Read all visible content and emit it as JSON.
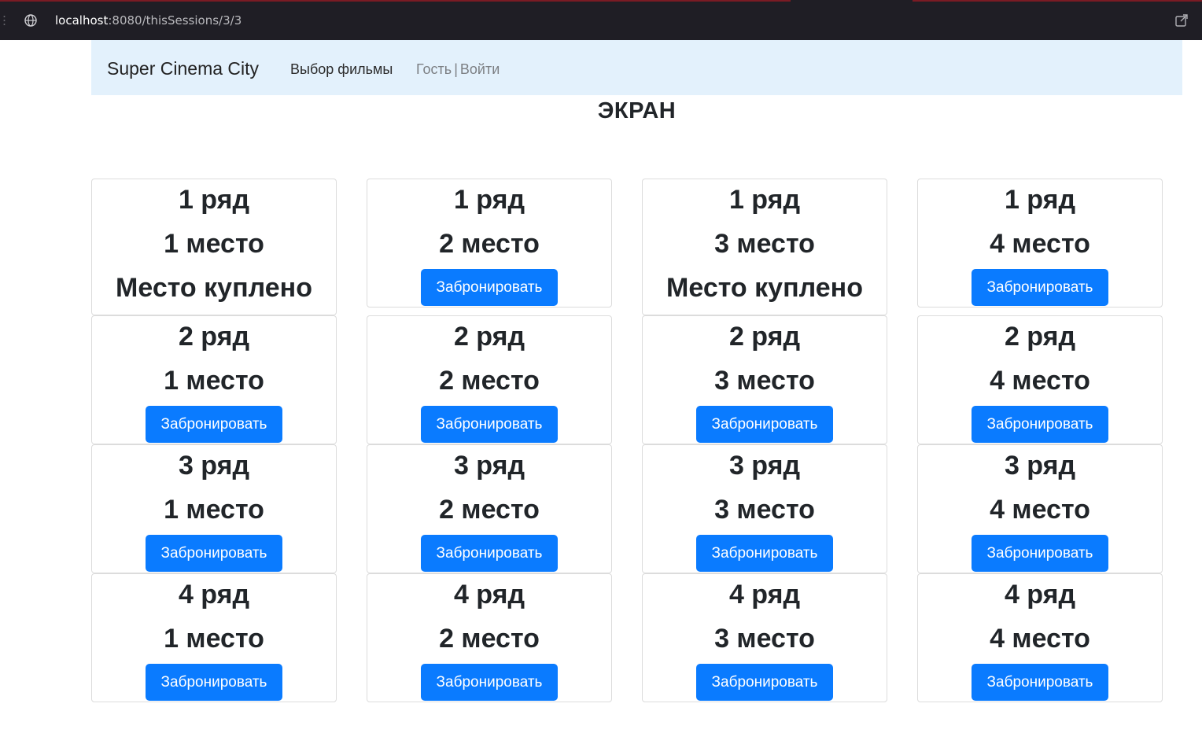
{
  "browser": {
    "url_host": "localhost",
    "url_path": ":8080/thisSessions/3/3"
  },
  "navbar": {
    "brand": "Super Cinema City",
    "films_link": "Выбор фильмы",
    "guest": "Гость",
    "separator": "|",
    "login_link": "Войти"
  },
  "screen_label": "ЭКРАН",
  "seats": [
    {
      "row": "1 ряд",
      "seat": "1 место",
      "status": "Место куплено"
    },
    {
      "row": "1 ряд",
      "seat": "2 место",
      "button": "Забронировать"
    },
    {
      "row": "1 ряд",
      "seat": "3 место",
      "status": "Место куплено"
    },
    {
      "row": "1 ряд",
      "seat": "4 место",
      "button": "Забронировать"
    },
    {
      "row": "2 ряд",
      "seat": "1 место",
      "button": "Забронировать"
    },
    {
      "row": "2 ряд",
      "seat": "2 место",
      "button": "Забронировать"
    },
    {
      "row": "2 ряд",
      "seat": "3 место",
      "button": "Забронировать"
    },
    {
      "row": "2 ряд",
      "seat": "4 место",
      "button": "Забронировать"
    },
    {
      "row": "3 ряд",
      "seat": "1 место",
      "button": "Забронировать"
    },
    {
      "row": "3 ряд",
      "seat": "2 место",
      "button": "Забронировать"
    },
    {
      "row": "3 ряд",
      "seat": "3 место",
      "button": "Забронировать"
    },
    {
      "row": "3 ряд",
      "seat": "4 место",
      "button": "Забронировать"
    },
    {
      "row": "4 ряд",
      "seat": "1 место",
      "button": "Забронировать"
    },
    {
      "row": "4 ряд",
      "seat": "2 место",
      "button": "Забронировать"
    },
    {
      "row": "4 ряд",
      "seat": "3 место",
      "button": "Забронировать"
    },
    {
      "row": "4 ряд",
      "seat": "4 место",
      "button": "Забронировать"
    }
  ]
}
